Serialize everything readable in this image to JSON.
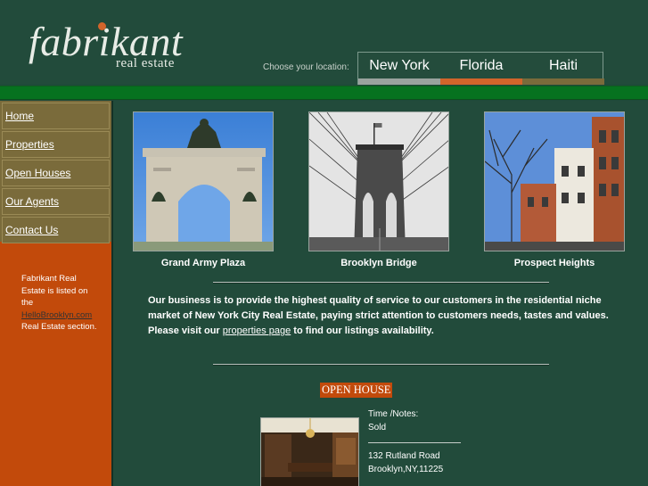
{
  "header": {
    "logo_main": "fabrikant",
    "logo_sub": "real estate",
    "choose_location_label": "Choose your location:",
    "locations": [
      {
        "label": "New York",
        "bar_color": "#9aa39e"
      },
      {
        "label": "Florida",
        "bar_color": "#d2652b"
      },
      {
        "label": "Haiti",
        "bar_color": "#7a6b3b"
      }
    ]
  },
  "sidebar": {
    "nav": [
      {
        "label": "Home"
      },
      {
        "label": "Properties"
      },
      {
        "label": "Open Houses"
      },
      {
        "label": "Our Agents"
      },
      {
        "label": "Contact Us"
      }
    ],
    "note_prefix": "Fabrikant Real Estate is listed on the",
    "note_link": "HelloBrooklyn.com",
    "note_suffix": "Real Estate section."
  },
  "gallery": [
    {
      "caption": "Grand Army Plaza"
    },
    {
      "caption": "Brooklyn Bridge"
    },
    {
      "caption": "Prospect Heights"
    }
  ],
  "about": {
    "text": "Our business is to provide the highest quality of service to our customers in the residential niche market of New York City Real Estate, paying strict attention to customers needs, tastes and values.",
    "visit_prefix": "Please visit our",
    "visit_link": "properties page",
    "visit_suffix": "to find our listings availability."
  },
  "open_house": {
    "title": "OPEN HOUSE",
    "time_notes_label": "Time /Notes:",
    "status": "Sold",
    "address_line1": "132 Rutland Road",
    "address_line2": "Brooklyn,NY,11225"
  },
  "colors": {
    "page_green": "#224b3b",
    "band_green": "#06721f",
    "sidebar_orange": "#c24a0b",
    "nav_olive": "#7a6b3b"
  }
}
